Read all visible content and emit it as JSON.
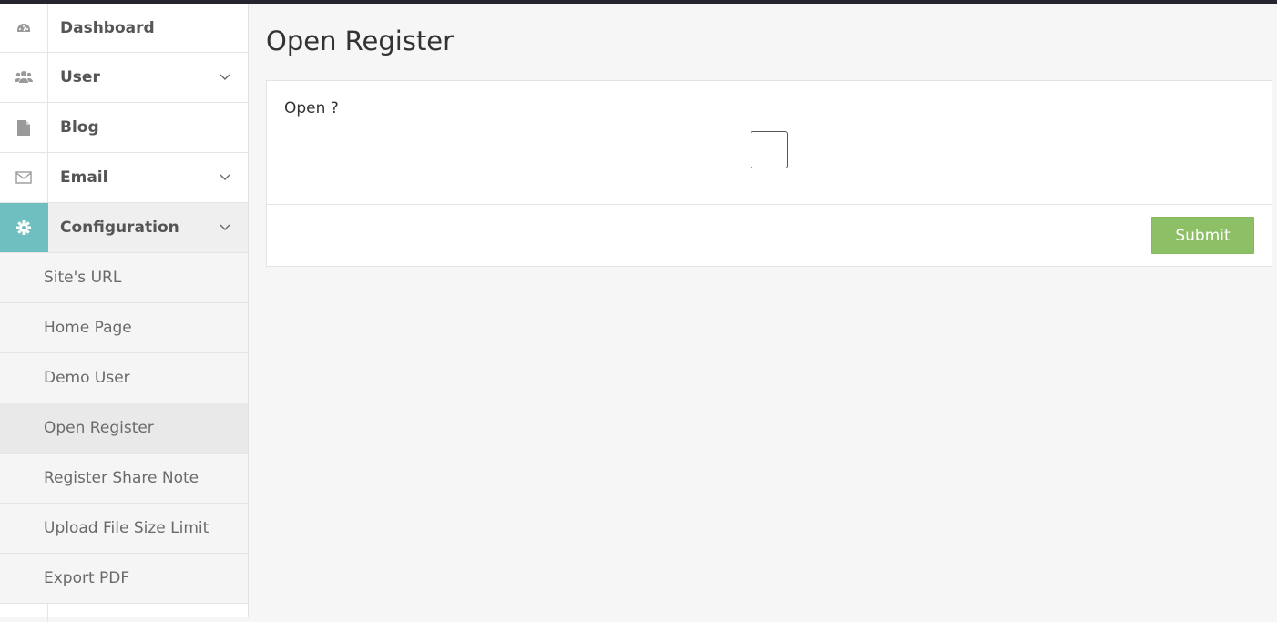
{
  "sidebar": {
    "items": [
      {
        "label": "Dashboard",
        "icon": "dashboard-icon"
      },
      {
        "label": "User",
        "icon": "users-icon"
      },
      {
        "label": "Blog",
        "icon": "document-icon"
      },
      {
        "label": "Email",
        "icon": "envelope-icon"
      },
      {
        "label": "Configuration",
        "icon": "gear-icon"
      }
    ],
    "config_subitems": [
      {
        "label": "Site's URL"
      },
      {
        "label": "Home Page"
      },
      {
        "label": "Demo User"
      },
      {
        "label": "Open Register"
      },
      {
        "label": "Register Share Note"
      },
      {
        "label": "Upload File Size Limit"
      },
      {
        "label": "Export PDF"
      }
    ],
    "active_subitem": "Open Register",
    "accent_color": "#6fbfc1"
  },
  "main": {
    "title": "Open Register",
    "form": {
      "field_label": "Open ?",
      "checkbox_checked": false,
      "submit_label": "Submit",
      "submit_color": "#8cbf66"
    }
  }
}
